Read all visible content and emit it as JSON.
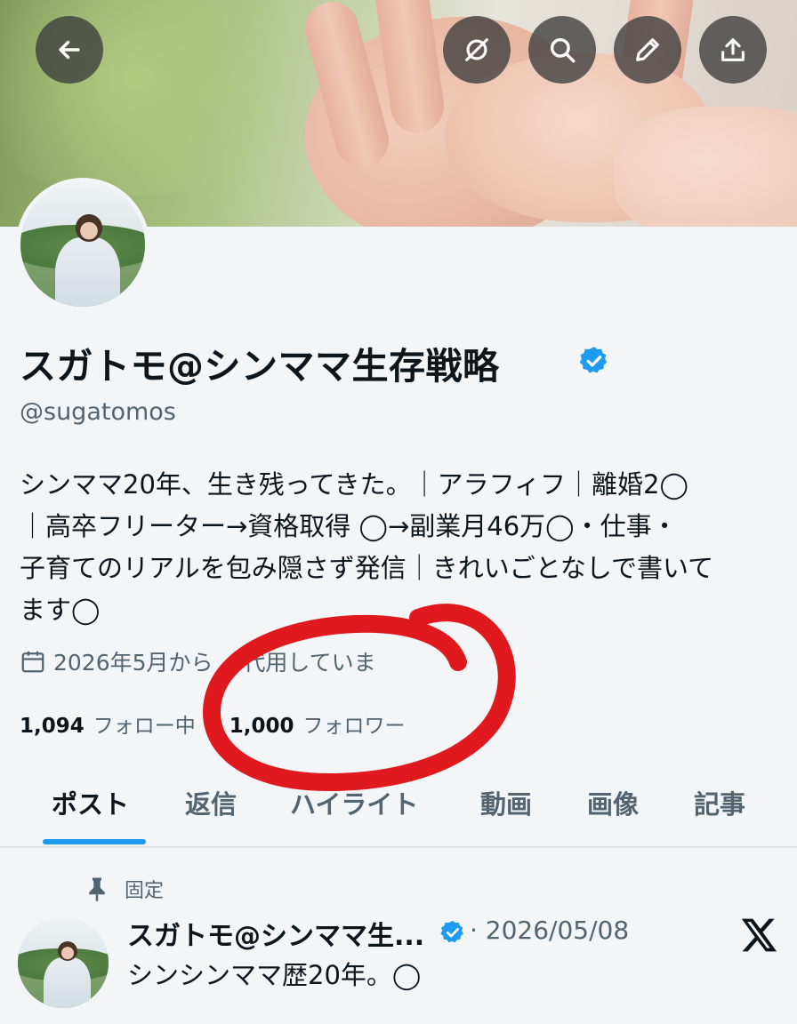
{
  "header": {
    "back_icon": "arrow-left-icon",
    "actions": [
      "grok-icon",
      "search-icon",
      "edit-icon",
      "share-icon"
    ]
  },
  "profile": {
    "name": "スガトモ@シンママ生存戦略",
    "handle": "@sugatomos",
    "bio_lines": [
      "シンママ20年、生き残ってきた。｜アラフィフ｜離婚2◯",
      "｜高卒フリーター→資格取得 ◯→副業月46万◯・仕事・",
      "子育てのリアルを包み隠さず発信｜きれいごとなしで書いて",
      "ます◯"
    ],
    "joined": "2026年5月から",
    "joined_overlap": "0代用していま",
    "following_count": "1,094",
    "following_label": "フォロー中",
    "followers_count": "1,000",
    "followers_label": "フォロワー"
  },
  "tabs": [
    {
      "label": "ポスト",
      "active": true
    },
    {
      "label": "返信",
      "active": false
    },
    {
      "label": "ハイライト",
      "active": false
    },
    {
      "label": "動画",
      "active": false
    },
    {
      "label": "画像",
      "active": false
    },
    {
      "label": "記事",
      "active": false
    }
  ],
  "pinned_post": {
    "pinned_label": "固定",
    "author": "スガトモ@シンママ生...",
    "date": "· 2026/05/08",
    "text": "シンシンママ歴20年。◯"
  },
  "colors": {
    "accent": "#1d9bf0",
    "annotation": "#e0191e"
  }
}
